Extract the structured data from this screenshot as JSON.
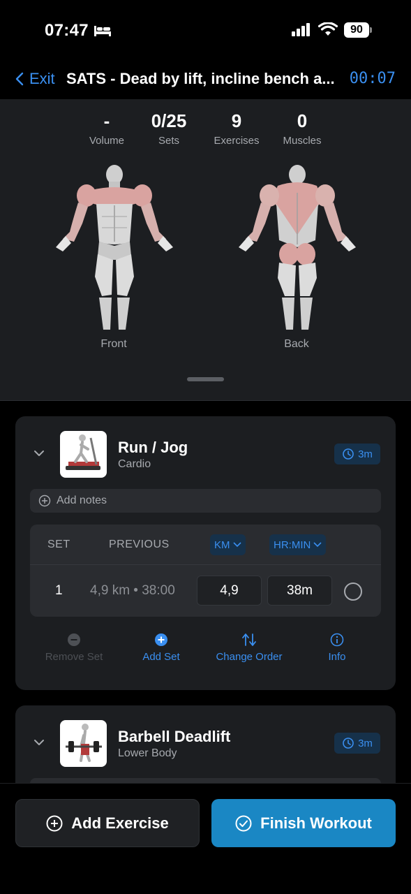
{
  "status_bar": {
    "time": "07:47",
    "battery": "90"
  },
  "nav": {
    "back_label": "Exit",
    "title": "SATS - Dead by lift, incline bench a...",
    "timer": "00:07"
  },
  "summary": {
    "stats": [
      {
        "value": "-",
        "label": "Volume"
      },
      {
        "value": "0/25",
        "label": "Sets"
      },
      {
        "value": "9",
        "label": "Exercises"
      },
      {
        "value": "0",
        "label": "Muscles"
      }
    ],
    "front_label": "Front",
    "back_label": "Back"
  },
  "exercises": [
    {
      "name": "Run / Jog",
      "category": "Cardio",
      "rest": "3m",
      "notes_placeholder": "Add notes",
      "table": {
        "col_set": "SET",
        "col_previous": "PREVIOUS",
        "col_unit1": "KM",
        "col_unit2": "HR:MIN",
        "rows": [
          {
            "set": "1",
            "previous": "4,9 km • 38:00",
            "value1": "4,9",
            "value2": "38m"
          }
        ]
      },
      "actions": {
        "remove_set": "Remove Set",
        "add_set": "Add Set",
        "change_order": "Change Order",
        "info": "Info"
      }
    },
    {
      "name": "Barbell Deadlift",
      "category": "Lower Body",
      "rest": "3m"
    }
  ],
  "bottom": {
    "add_exercise": "Add Exercise",
    "finish_workout": "Finish Workout"
  },
  "colors": {
    "accent": "#3a8ff0",
    "finish": "#1a87c4",
    "card": "#1c1e21",
    "muscle_highlight": "#d9a3a0"
  }
}
